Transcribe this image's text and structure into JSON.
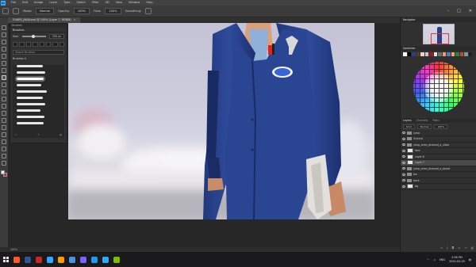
{
  "menubar": {
    "logo": "Ps",
    "items": [
      "File",
      "Edit",
      "Image",
      "Layer",
      "Type",
      "Select",
      "Filter",
      "3D",
      "View",
      "Window",
      "Help"
    ]
  },
  "options": {
    "mode_label": "Mode:",
    "mode_value": "Normal",
    "opacity_label": "Opacity:",
    "opacity_value": "100%",
    "flow_label": "Flow:",
    "flow_value": "100%",
    "smoothing_label": "Smoothing:"
  },
  "document": {
    "tab_title": "CHARE_JAVALand @ 100% (Layer 7, RGB/8)",
    "zoom_status": "100%"
  },
  "brush_panel": {
    "tab": "Brushes",
    "title": "Brushes",
    "size_label": "Size:",
    "size_value": "200 px",
    "search_placeholder": "Search Brushes",
    "group_name": "Brushes 4"
  },
  "navigator": {
    "tabs": [
      "Navigator"
    ]
  },
  "swatches_panel": {
    "title": "Swatches",
    "colors": [
      "#ffffff",
      "#000000",
      "#2b3f8a",
      "#5a3c2e",
      "#f2d2b8",
      "#c9c8da",
      "#9c1c1c",
      "#e3e3e3",
      "#6e6e6e",
      "#f0a070",
      "#5577bb",
      "#d8b070",
      "#3a7a3a",
      "#aa5533",
      "#8f8fa0",
      "#202020"
    ]
  },
  "layers_panel": {
    "tabs": [
      "Layers",
      "Channels",
      "Paths"
    ],
    "kind": "Kind",
    "blend": "Normal",
    "opacity": "100%",
    "layers": [
      {
        "name": "jump",
        "kind": "folder",
        "selected": false
      },
      {
        "name": "Ground",
        "kind": "folder",
        "selected": false
      },
      {
        "name": "jump_arms_dressed_a_nikes",
        "kind": "folder",
        "selected": false
      },
      {
        "name": "fore",
        "kind": "layer",
        "selected": false
      },
      {
        "name": "Layer 6",
        "kind": "layer",
        "selected": false
      },
      {
        "name": "Layer 7",
        "kind": "layer",
        "selected": true
      },
      {
        "name": "jump_arms_dressed_a_board",
        "kind": "folder",
        "selected": false
      },
      {
        "name": "bw",
        "kind": "folder",
        "selected": false
      },
      {
        "name": "back",
        "kind": "folder",
        "selected": false
      },
      {
        "name": "bg",
        "kind": "layer",
        "selected": false
      }
    ]
  },
  "taskbar": {
    "lang": "ENG",
    "time": "2:58 PM",
    "date": "2020-02-29",
    "apps": [
      "#ff5a1f",
      "#2b579a",
      "#c62828",
      "#31a8ff",
      "#ff9a00",
      "#4a90e2",
      "#7b61ff",
      "#1d9bf0",
      "#31a8ff",
      "#7fba00"
    ]
  }
}
